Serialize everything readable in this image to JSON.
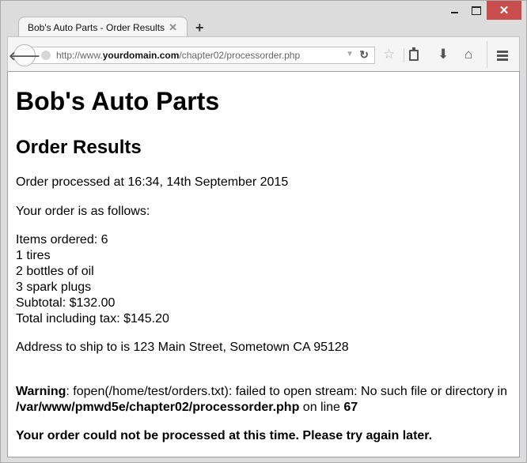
{
  "browser": {
    "tab_title": "Bob's Auto Parts - Order Results",
    "url_prefix": "http://www.",
    "url_domain": "yourdomain.com",
    "url_path": "/chapter02/processorder.php",
    "icons": [
      "back-arrow-icon",
      "globe-icon",
      "dropdown-triangle-icon",
      "reload-icon",
      "star-bookmark-icon",
      "clipboard-reading-list-icon",
      "download-arrow-icon",
      "home-icon",
      "hamburger-menu-icon"
    ],
    "window_buttons": [
      "minimize",
      "maximize",
      "close"
    ],
    "close_color": "#c94d4d"
  },
  "page": {
    "title": "Bob's Auto Parts",
    "subtitle": "Order Results",
    "processed_at": "Order processed at 16:34, 14th September 2015",
    "intro": "Your order is as follows:",
    "order_lines": [
      "Items ordered: 6",
      "1 tires",
      "2 bottles of oil",
      "3 spark plugs",
      "Subtotal: $132.00",
      "Total including tax: $145.20"
    ],
    "address": "Address to ship to is 123 Main Street, Sometown CA 95128",
    "warning": {
      "label": "Warning",
      "message": ": fopen(/home/test/orders.txt): failed to open stream: No such file or directory in",
      "file": "/var/www/pmwd5e/chapter02/processorder.php",
      "on_line_text": " on line ",
      "line": "67"
    },
    "failure_message": "Your order could not be processed at this time. Please try again later."
  }
}
